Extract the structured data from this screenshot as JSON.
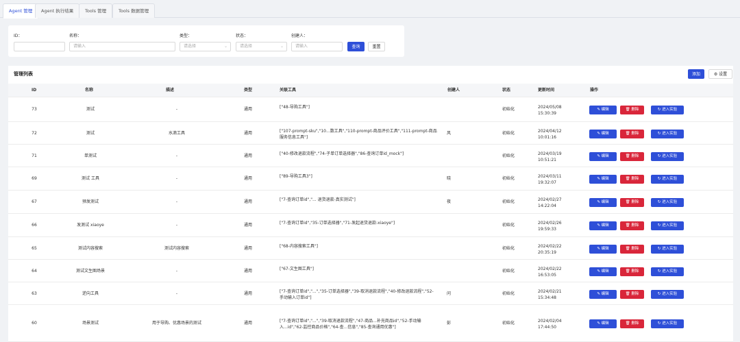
{
  "tabs": [
    {
      "label": "Agent 管理",
      "active": true
    },
    {
      "label": "Agent 执行结果",
      "active": false
    },
    {
      "label": "Tools 管理",
      "active": false
    },
    {
      "label": "Tools 数据管理",
      "active": false
    }
  ],
  "filters": {
    "id_label": "ID：",
    "name_label": "名称：",
    "name_placeholder": "请输入",
    "type_label": "类型：",
    "type_placeholder": "请选择",
    "status_label": "状态：",
    "status_placeholder": "请选择",
    "creator_label": "创建人：",
    "creator_placeholder": "请输入",
    "query_button": "查询",
    "reset_button": "重置"
  },
  "list": {
    "title": "管理列表",
    "add_button": "添加",
    "settings_button": "设置",
    "columns": [
      "ID",
      "名称",
      "描述",
      "类型",
      "关联工具",
      "创建人",
      "状态",
      "更新时间",
      "操作"
    ],
    "actions": {
      "edit": "编辑",
      "delete": "删除",
      "experiment": "进入实验"
    },
    "rows": [
      {
        "id": "73",
        "name": "测试",
        "desc": "-",
        "type": "通用",
        "tools": "[\"48-导购工具\"]",
        "creator": "",
        "status": "初始化",
        "updated": "2024/05/08 15:30:39"
      },
      {
        "id": "72",
        "name": "测试",
        "desc": "水滴工具",
        "type": "通用",
        "tools": "[\"107-prompt-sku\",\"10...数工具\",\"110-prompt-商品评价工具\",\"111-prompt-商品服务信息工具\"]",
        "creator": "风",
        "status": "初始化",
        "updated": "2024/04/12 10:01:16"
      },
      {
        "id": "71",
        "name": "单测试",
        "desc": "-",
        "type": "通用",
        "tools": "[\"40-修改退款流程\",\"74-子单订单选择器\",\"86-查询订单id_mock\"]",
        "creator": "",
        "status": "初始化",
        "updated": "2024/03/19 10:51:21"
      },
      {
        "id": "69",
        "name": "测试 工具",
        "desc": "-",
        "type": "通用",
        "tools": "[\"89-导购工具3\"]",
        "creator": "晓",
        "status": "初始化",
        "updated": "2024/03/11 19:32:07"
      },
      {
        "id": "67",
        "name": "预发测试",
        "desc": "-",
        "type": "通用",
        "tools": "[\"7-查询订单id\",\"... 退货退款-真实测试\"]",
        "creator": "夜",
        "status": "初始化",
        "updated": "2024/02/27 14:22:04"
      },
      {
        "id": "66",
        "name": "发测试 xiaoye",
        "desc": "-",
        "type": "通用",
        "tools": "[\"7-查询订单id\",\"35-订单选择器\",\"71-发起退货退款-xiaoye\"]",
        "creator": "",
        "status": "初始化",
        "updated": "2024/02/26 19:59:33"
      },
      {
        "id": "65",
        "name": "测试内容搜索",
        "desc": "测试内容搜索",
        "type": "通用",
        "tools": "[\"68-内容搜索工具\"]",
        "creator": "",
        "status": "初始化",
        "updated": "2024/02/22 20:35:19"
      },
      {
        "id": "64",
        "name": "测试文生图场景",
        "desc": "-",
        "type": "通用",
        "tools": "[\"67-文生图工具\"]",
        "creator": "",
        "status": "初始化",
        "updated": "2024/02/22 16:53:05"
      },
      {
        "id": "63",
        "name": "逆向工具",
        "desc": "-",
        "type": "通用",
        "tools": "[\"7-查询订单id\",\"...\",\"35-订单选择器\",\"39-取消退款流程\",\"40-修改退款流程\",\"52-手动输入订单id\"]",
        "creator": "问",
        "status": "初始化",
        "updated": "2024/02/21 15:34:48"
      },
      {
        "id": "60",
        "name": "场景测试",
        "desc": "用于导购、优惠场景的测试",
        "type": "通用",
        "tools": "[\"7-查询订单id\",\"...\",\"39-取消退款流程\",\"47-商品...补充商品id\",\"52-手动输入...id\",\"62-监控商品价格\",\"64-查...信息\",\"85-查询通用优惠\"]",
        "creator": "彭",
        "status": "初始化",
        "updated": "2024/02/04 17:44:50"
      }
    ]
  },
  "icons": {
    "edit": "edit-icon",
    "delete": "trash-icon",
    "experiment": "refresh-icon",
    "settings": "gear-icon",
    "dropdown": "chevron-down-icon"
  },
  "colors": {
    "primary": "#2e4fd8",
    "danger": "#d9263a"
  }
}
